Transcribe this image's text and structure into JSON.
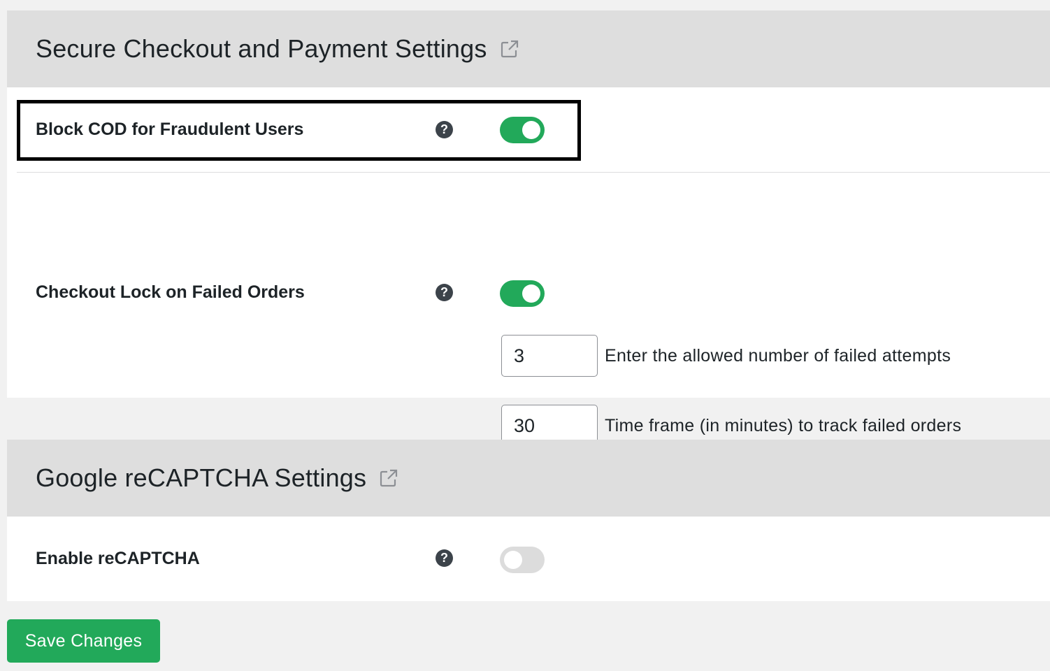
{
  "sections": [
    {
      "title": "Secure Checkout and Payment Settings",
      "link_icon": "external-link-icon",
      "settings": [
        {
          "label": "Block COD for Fraudulent Users",
          "help_icon": "question-circle-icon",
          "help_glyph": "?",
          "enabled": true
        },
        {
          "label": "Checkout Lock on Failed Orders",
          "help_icon": "question-circle-icon",
          "help_glyph": "?",
          "enabled": true,
          "fields": [
            {
              "value": "3",
              "description": "Enter the allowed number of failed attempts"
            },
            {
              "value": "30",
              "description": "Time frame (in minutes) to track failed orders"
            }
          ]
        }
      ]
    },
    {
      "title": "Google reCAPTCHA Settings",
      "link_icon": "external-link-icon",
      "settings": [
        {
          "label": "Enable reCAPTCHA",
          "help_icon": "question-circle-icon",
          "help_glyph": "?",
          "enabled": false
        }
      ]
    }
  ],
  "save_button": {
    "label": "Save Changes"
  },
  "colors": {
    "accent": "#22a95a",
    "toggle_off": "#dcdcdc",
    "header_bg": "#dedede",
    "page_bg": "#f1f1f1",
    "highlight_border": "#000000"
  }
}
